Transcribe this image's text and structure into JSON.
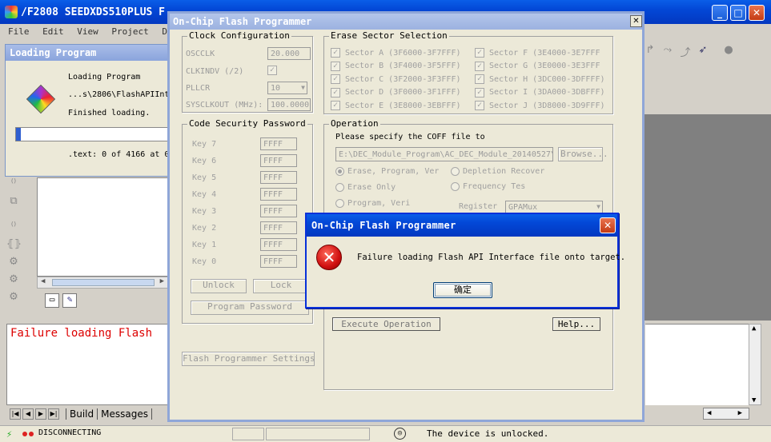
{
  "main_window": {
    "title": "/F2808 SEEDXDS510PLUS F",
    "menu": [
      "File",
      "Edit",
      "View",
      "Project",
      "Debug"
    ],
    "status_left": "DISCONNECTING",
    "status_right": "The device is unlocked."
  },
  "loading_panel": {
    "title": "Loading Program",
    "line1": "Loading Program",
    "line2": "...s\\2806\\FlashAPIInt",
    "line3": "Finished loading.",
    "progress": 0.03,
    "text_status": ".text: 0 of 4166 at 0"
  },
  "output": {
    "text": "Failure loading Flash",
    "tabs": [
      "Build",
      "Messages"
    ]
  },
  "flash_dialog": {
    "title": "On-Chip Flash Programmer",
    "clock": {
      "label": "Clock Configuration",
      "oscclk_label": "OSCCLK",
      "oscclk_value": "20.000",
      "clkindiv_label": "CLKINDV (/2)",
      "pllcr_label": "PLLCR",
      "pllcr_value": "10",
      "sysclk_label": "SYSCLKOUT (MHz):",
      "sysclk_value": "100.0000"
    },
    "erase": {
      "label": "Erase Sector Selection",
      "sectors_left": [
        "Sector A (3F6000-3F7FFF)",
        "Sector B (3F4000-3F5FFF)",
        "Sector C (3F2000-3F3FFF)",
        "Sector D (3F0000-3F1FFF)",
        "Sector E (3E8000-3EBFFF)"
      ],
      "sectors_right": [
        "Sector F (3E4000-3E7FFF",
        "Sector G (3E0000-3E3FFF",
        "Sector H (3DC000-3DFFFF)",
        "Sector I (3DA000-3DBFFF)",
        "Sector J (3D8000-3D9FFF)"
      ]
    },
    "security": {
      "label": "Code Security Password",
      "keys": [
        "Key 7",
        "Key 6",
        "Key 5",
        "Key 4",
        "Key 3",
        "Key 2",
        "Key 1",
        "Key 0"
      ],
      "value": "FFFF",
      "unlock_label": "Unlock",
      "lock_label": "Lock",
      "program_password_label": "Program Password"
    },
    "operation": {
      "label": "Operation",
      "prompt": "Please specify the COFF file to",
      "path": "E:\\DEC_Module_Program\\AC_DEC_Module_20140527\\",
      "browse_label": "Browse...",
      "opt_erase_program": "Erase, Program, Ver",
      "opt_depletion": "Depletion Recover",
      "opt_erase_only": "Erase Only",
      "opt_frequency": "Frequency Tes",
      "opt_program_verify": "Program, Veri",
      "register_label": "Register",
      "register_value": "GPAMux",
      "execute_label": "Execute Operation",
      "help_label": "Help..."
    },
    "settings_label": "Flash Programmer Settings..."
  },
  "error_dialog": {
    "title": "On-Chip Flash Programmer",
    "message": "Failure loading Flash API Interface file onto target.",
    "ok_label": "确定"
  }
}
